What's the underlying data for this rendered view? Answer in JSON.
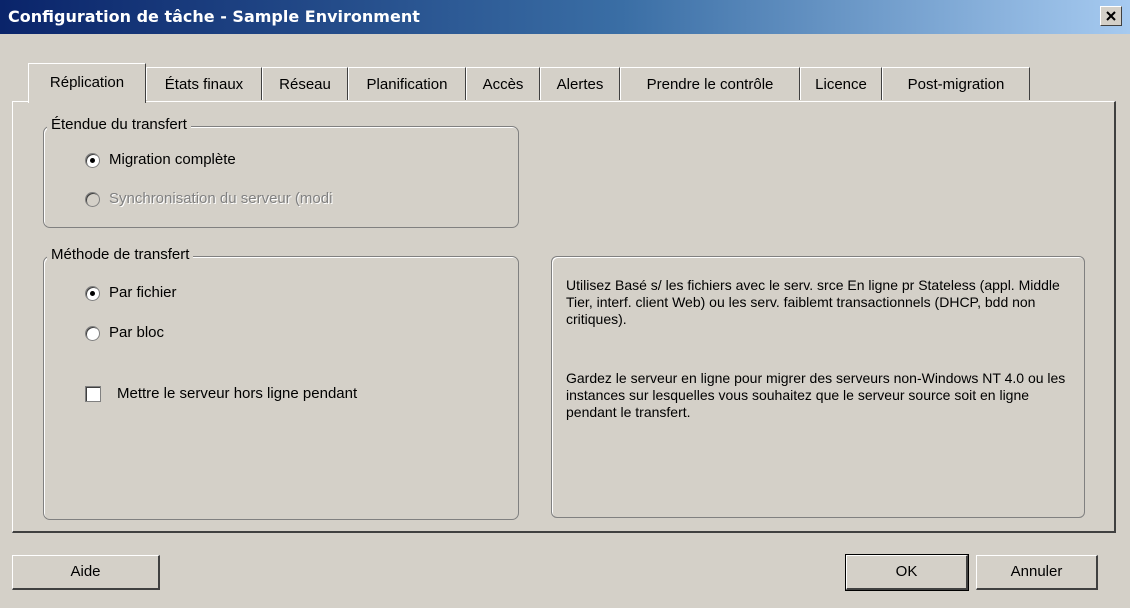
{
  "window": {
    "title": "Configuration de tâche - Sample Environment"
  },
  "tabs": [
    {
      "label": "Réplication",
      "active": true
    },
    {
      "label": "États finaux"
    },
    {
      "label": "Réseau"
    },
    {
      "label": "Planification"
    },
    {
      "label": "Accès"
    },
    {
      "label": "Alertes"
    },
    {
      "label": "Prendre le contrôle"
    },
    {
      "label": "Licence"
    },
    {
      "label": "Post-migration"
    }
  ],
  "scope_group": {
    "legend": "Étendue du transfert",
    "options": [
      {
        "label": "Migration complète",
        "checked": true,
        "enabled": true
      },
      {
        "label": "Synchronisation du serveur (modi",
        "checked": false,
        "enabled": false
      }
    ]
  },
  "method_group": {
    "legend": "Méthode de transfert",
    "options": [
      {
        "label": "Par fichier",
        "checked": true
      },
      {
        "label": "Par bloc",
        "checked": false
      }
    ],
    "offline_checkbox": {
      "label": "Mettre le serveur hors ligne pendant",
      "checked": false
    }
  },
  "info": {
    "paragraph1": "Utilisez Basé s/ les fichiers avec le serv. srce En ligne pr Stateless (appl. Middle Tier, interf. client Web) ou les serv. faiblemt transactionnels (DHCP, bdd non critiques).",
    "paragraph2": "Gardez le serveur en ligne pour migrer des serveurs non-Windows NT 4.0 ou les instances sur lesquelles vous souhaitez que le serveur source soit en ligne pendant le transfert."
  },
  "buttons": {
    "help": "Aide",
    "ok": "OK",
    "cancel": "Annuler"
  }
}
